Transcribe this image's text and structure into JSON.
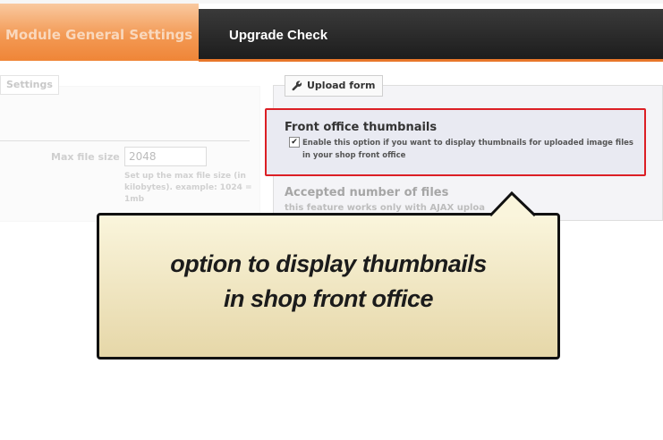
{
  "tabs": {
    "general": "Module General Settings",
    "upgrade": "Upgrade Check"
  },
  "left_panel": {
    "legend": "Settings",
    "max_file_size_label": "Max file size",
    "max_file_size_value": "2048",
    "max_file_size_help": "Set up the max file size (in kilobytes). example: 1024 = 1mb"
  },
  "upload_form": {
    "legend": "Upload form",
    "legend_icon": "wrench-icon",
    "thumbnails": {
      "title": "Front office thumbnails",
      "checked": true,
      "description": "Enable this option if you want to display thumbnails for uploaded image files in your shop front office"
    },
    "accepted": {
      "title": "Accepted number of files",
      "subtitle": "this feature works only with AJAX uploa"
    }
  },
  "callout": {
    "line1": "option to display thumbnails",
    "line2": "in shop front office"
  },
  "colors": {
    "active_tab": "#ef8537",
    "dark_tab": "#1c1c1c",
    "highlight_border": "#dc1f25",
    "callout_bg": "#e6d7a8"
  }
}
